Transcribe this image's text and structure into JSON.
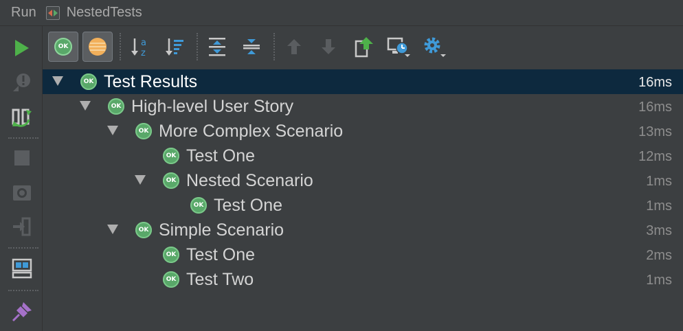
{
  "window": {
    "run_label": "Run",
    "config_name": "NestedTests"
  },
  "left_toolbar": {
    "items": [
      "rerun",
      "rerun-failed",
      "toggle-auto-test",
      "stop",
      "dump-threads",
      "exit",
      "restore-layout",
      "pin-tab"
    ]
  },
  "top_toolbar": {
    "items": [
      "show-passed",
      "show-ignored",
      "sort-alphabetically",
      "sort-by-duration",
      "expand-all",
      "collapse-all",
      "previous-failed",
      "next-failed",
      "export-results",
      "import-results",
      "settings"
    ]
  },
  "colors": {
    "ok_green": "#59a869",
    "run_green": "#4eb14a",
    "selection": "#0d293e",
    "icon_blue": "#3f9ad8"
  },
  "tree": {
    "rows": [
      {
        "label": "Test Results",
        "duration": "16ms",
        "status": "OK"
      },
      {
        "label": "High-level User Story",
        "duration": "16ms",
        "status": "OK"
      },
      {
        "label": "More Complex Scenario",
        "duration": "13ms",
        "status": "OK"
      },
      {
        "label": "Test One",
        "duration": "12ms",
        "status": "OK"
      },
      {
        "label": "Nested Scenario",
        "duration": "1ms",
        "status": "OK"
      },
      {
        "label": "Test One",
        "duration": "1ms",
        "status": "OK"
      },
      {
        "label": "Simple Scenario",
        "duration": "3ms",
        "status": "OK"
      },
      {
        "label": "Test One",
        "duration": "2ms",
        "status": "OK"
      },
      {
        "label": "Test Two",
        "duration": "1ms",
        "status": "OK"
      }
    ]
  }
}
